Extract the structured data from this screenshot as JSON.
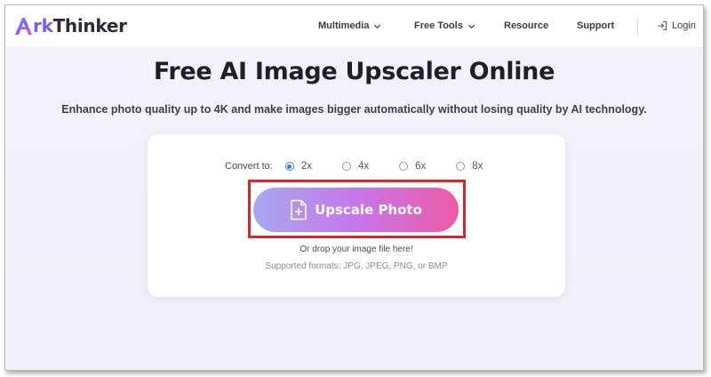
{
  "brand": {
    "logo_letter": "A",
    "name_accent": "rk",
    "name_rest": "Thinker",
    "accent_color": "#7a5cf5"
  },
  "nav": {
    "items": [
      {
        "label": "Multimedia",
        "has_dropdown": true
      },
      {
        "label": "Free Tools",
        "has_dropdown": true
      },
      {
        "label": "Resource",
        "has_dropdown": false
      },
      {
        "label": "Support",
        "has_dropdown": false
      }
    ],
    "login_label": "Login",
    "icons": {
      "dropdown": "chevron-down-icon",
      "login": "login-icon"
    }
  },
  "hero": {
    "title": "Free AI Image Upscaler Online",
    "subtitle": "Enhance photo quality up to 4K and make images bigger automatically without losing quality by AI technology."
  },
  "upload_card": {
    "convert_label": "Convert to:",
    "scale_options": [
      {
        "label": "2x",
        "checked": true
      },
      {
        "label": "4x",
        "checked": false
      },
      {
        "label": "6x",
        "checked": false
      },
      {
        "label": "8x",
        "checked": false
      }
    ],
    "upscale_button_label": "Upscale Photo",
    "button_icon": "add-file-icon",
    "drop_text": "Or drop your image file here!",
    "formats_text": "Supported formats: JPG, JPEG, PNG, or BMP",
    "highlight_color": "#d6262e",
    "button_gradient": [
      "#a8a8f0",
      "#c776ec",
      "#ee5aa6"
    ]
  }
}
